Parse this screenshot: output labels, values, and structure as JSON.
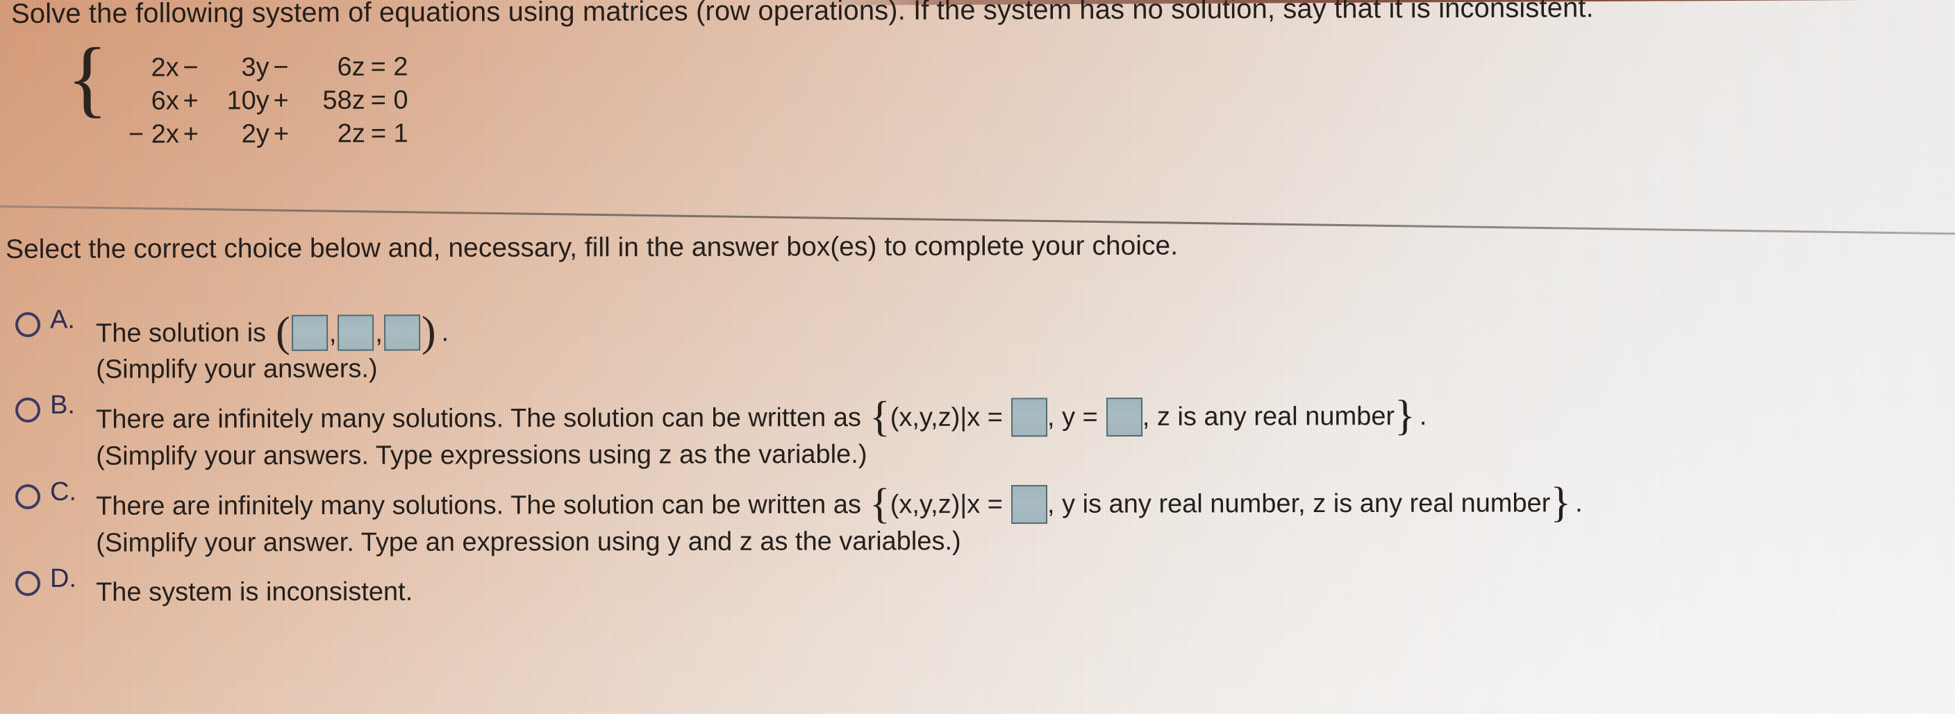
{
  "question": {
    "prompt": "Solve the following system of equations using matrices (row operations). If the system has no solution, say that it is inconsistent.",
    "system": [
      {
        "x": "2x",
        "op1": "−",
        "y": "3y",
        "op2": "−",
        "z": "6z",
        "eq": "= 2"
      },
      {
        "x": "6x",
        "op1": "+",
        "y": "10y",
        "op2": "+",
        "z": "58z",
        "eq": "= 0"
      },
      {
        "x": "− 2x",
        "op1": "+",
        "y": "2y",
        "op2": "+",
        "z": "2z",
        "eq": "= 1"
      }
    ],
    "brace": "{"
  },
  "instruction": "Select the correct choice below and, necessary, fill in the answer box(es) to complete your choice.",
  "choices": [
    {
      "letter": "A.",
      "selected": false,
      "lead": "The solution is",
      "open_paren": "(",
      "close_paren": ")",
      "comma": ",",
      "trailing_period": ".",
      "boxes": 3,
      "note": "(Simplify your answers.)"
    },
    {
      "letter": "B.",
      "selected": false,
      "lead": "There are infinitely many solutions. The solution can be written as",
      "set_open": "{",
      "set_prefix": "(x,y,z)|x =",
      "mid": ", y =",
      "tail": ", z is any real number",
      "set_close": "}",
      "trailing_period": ".",
      "note": "(Simplify your answers. Type expressions using z as the variable.)"
    },
    {
      "letter": "C.",
      "selected": false,
      "lead": "There are infinitely many solutions. The solution can be written as",
      "set_open": "{",
      "set_prefix": "(x,y,z)|x =",
      "tail": ", y is any real number, z is any real number",
      "set_close": "}",
      "trailing_period": ".",
      "note": "(Simplify your answer. Type an expression using y and z as the variables.)"
    },
    {
      "letter": "D.",
      "selected": false,
      "lead": "The system is inconsistent.",
      "note": ""
    }
  ],
  "colors": {
    "background_warm": "#d8966e",
    "background_cool": "#f6f6f6",
    "text": "#241f1c",
    "radio_outline": "#3c3a63",
    "answer_box_fill": "#a8bac2",
    "answer_box_border": "#4f6a72",
    "divider": "#68605a"
  }
}
